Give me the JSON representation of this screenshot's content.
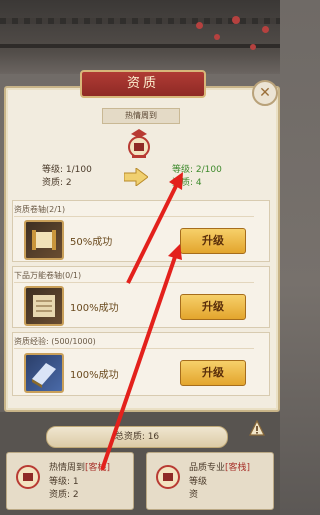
{
  "dialog": {
    "title": "资质",
    "close_icon": "close-x-icon",
    "hero": {
      "name": "热情周到"
    },
    "current": {
      "level_label": "等级: 1/100",
      "aptitude_label": "资质: 2"
    },
    "next": {
      "level_label": "等级: 2/100",
      "aptitude_label": "资质: 4"
    },
    "rows": [
      {
        "title": "资质卷轴(2/1)",
        "rate": "50%成功",
        "button": "升级",
        "icon": "scroll-icon"
      },
      {
        "title": "下品万能卷轴(0/1)",
        "rate": "100%成功",
        "button": "升级",
        "icon": "universal-scroll-icon"
      },
      {
        "title": "资质经验: (500/1000)",
        "rate": "100%成功",
        "button": "升级",
        "icon": "book-icon"
      }
    ]
  },
  "bottom": {
    "total_label": "总资质: 16",
    "cards": [
      {
        "line1_a": "热情周到",
        "line1_b": "[客栈]",
        "line2": "等级: 1",
        "line3": "资质: 2"
      },
      {
        "line1_a": "品质专业",
        "line1_b": "[客栈]",
        "line2": "等级",
        "line3": "资"
      }
    ]
  },
  "colors": {
    "accent": "#b03b35",
    "button": "#e8ad35",
    "annotation_arrow": "#e3211c",
    "next_stat": "#3f8a2d"
  }
}
